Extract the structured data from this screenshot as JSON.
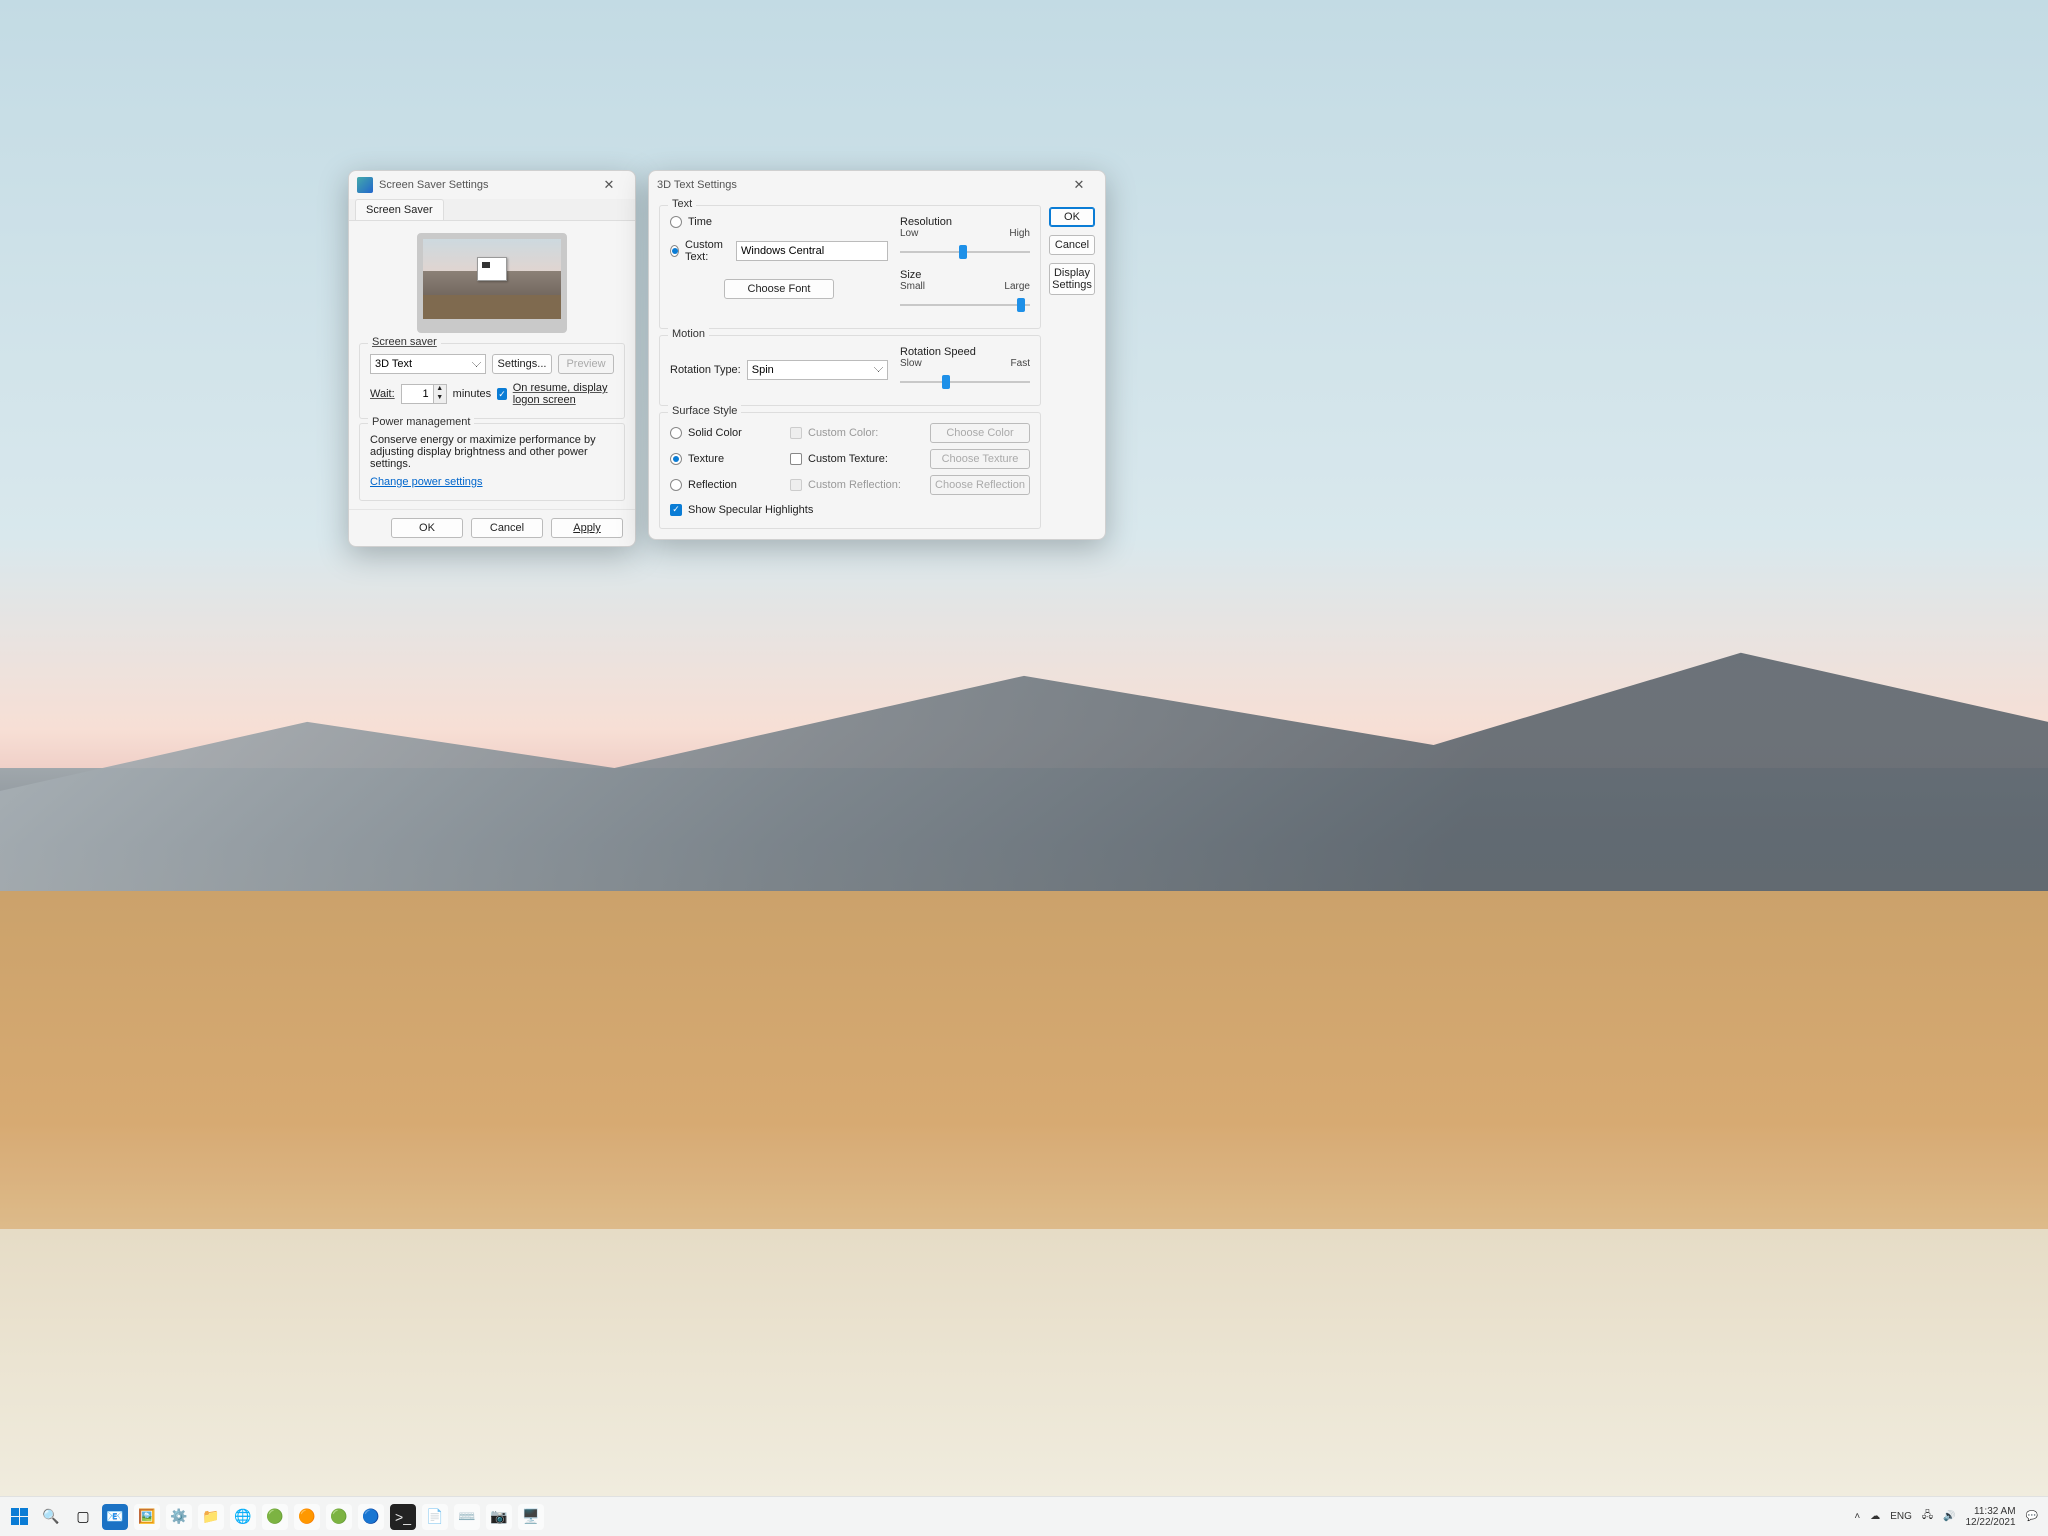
{
  "screensaver": {
    "title": "Screen Saver Settings",
    "tab": "Screen Saver",
    "group_label": "Screen saver",
    "selected": "3D Text",
    "settings_btn": "Settings...",
    "preview_btn": "Preview",
    "wait_label": "Wait:",
    "wait_value": "1",
    "wait_unit": "minutes",
    "resume_label": "On resume, display logon screen",
    "power_group": "Power management",
    "power_text": "Conserve energy or maximize performance by adjusting display brightness and other power settings.",
    "power_link": "Change power settings",
    "ok": "OK",
    "cancel": "Cancel",
    "apply": "Apply"
  },
  "td": {
    "title": "3D Text Settings",
    "text_group": "Text",
    "time_label": "Time",
    "custom_label": "Custom Text:",
    "custom_value": "Windows Central",
    "choose_font": "Choose Font",
    "resolution": "Resolution",
    "low": "Low",
    "high": "High",
    "size": "Size",
    "small": "Small",
    "large": "Large",
    "motion_group": "Motion",
    "rotation_type": "Rotation Type:",
    "rotation_value": "Spin",
    "rotation_speed": "Rotation Speed",
    "slow": "Slow",
    "fast": "Fast",
    "surface_group": "Surface Style",
    "solid": "Solid Color",
    "custom_color": "Custom Color:",
    "choose_color": "Choose Color",
    "texture": "Texture",
    "custom_texture": "Custom Texture:",
    "choose_texture": "Choose Texture",
    "reflection": "Reflection",
    "custom_reflection": "Custom Reflection:",
    "choose_reflection": "Choose Reflection",
    "show_specular": "Show Specular Highlights",
    "ok": "OK",
    "cancel": "Cancel",
    "display_settings": "Display Settings"
  },
  "taskbar": {
    "lang": "ENG",
    "time": "11:32 AM",
    "date": "12/22/2021"
  }
}
